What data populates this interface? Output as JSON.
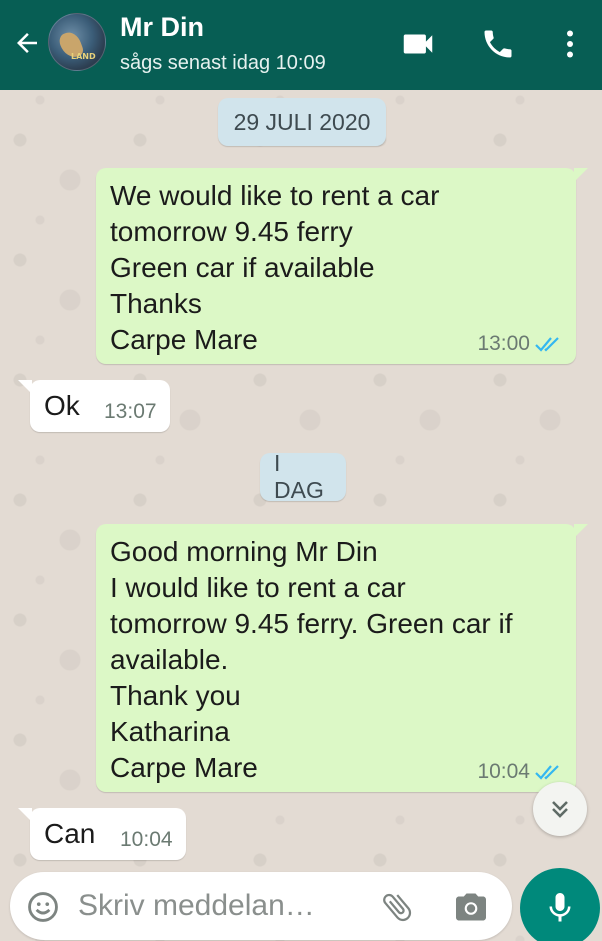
{
  "header": {
    "contact_name": "Mr Din",
    "status": "sågs senast idag 10:09",
    "avatar_text": "LAND",
    "bg_color": "#075e54"
  },
  "icons": {
    "back": "arrow-back-icon",
    "video": "videocam-icon",
    "phone": "phone-icon",
    "menu": "more-vert-icon",
    "emoji": "emoji-icon",
    "attach": "paperclip-icon",
    "camera": "camera-icon",
    "mic": "mic-icon",
    "scroll": "double-chevron-down-icon"
  },
  "dates": {
    "first": "29 JULI 2020",
    "second": "I DAG"
  },
  "messages": [
    {
      "direction": "outgoing",
      "text": "We would like to rent a car\ntomorrow 9.45 ferry\nGreen car if available\nThanks\nCarpe Mare",
      "time": "13:00",
      "status": "read"
    },
    {
      "direction": "incoming",
      "text": "Ok",
      "time": "13:07"
    },
    {
      "direction": "outgoing",
      "text": "Good morning Mr Din\nI would like to rent a car\ntomorrow 9.45 ferry. Green car if\navailable.\nThank you\nKatharina\nCarpe Mare",
      "time": "10:04",
      "status": "read"
    },
    {
      "direction": "incoming",
      "text": "Can",
      "time": "10:04"
    }
  ],
  "composer": {
    "placeholder": "Skriv meddelan…"
  },
  "colors": {
    "outgoing_bubble": "#dcf8c6",
    "incoming_bubble": "#ffffff",
    "read_ticks": "#34b7f1",
    "mic_button": "#00897b"
  }
}
